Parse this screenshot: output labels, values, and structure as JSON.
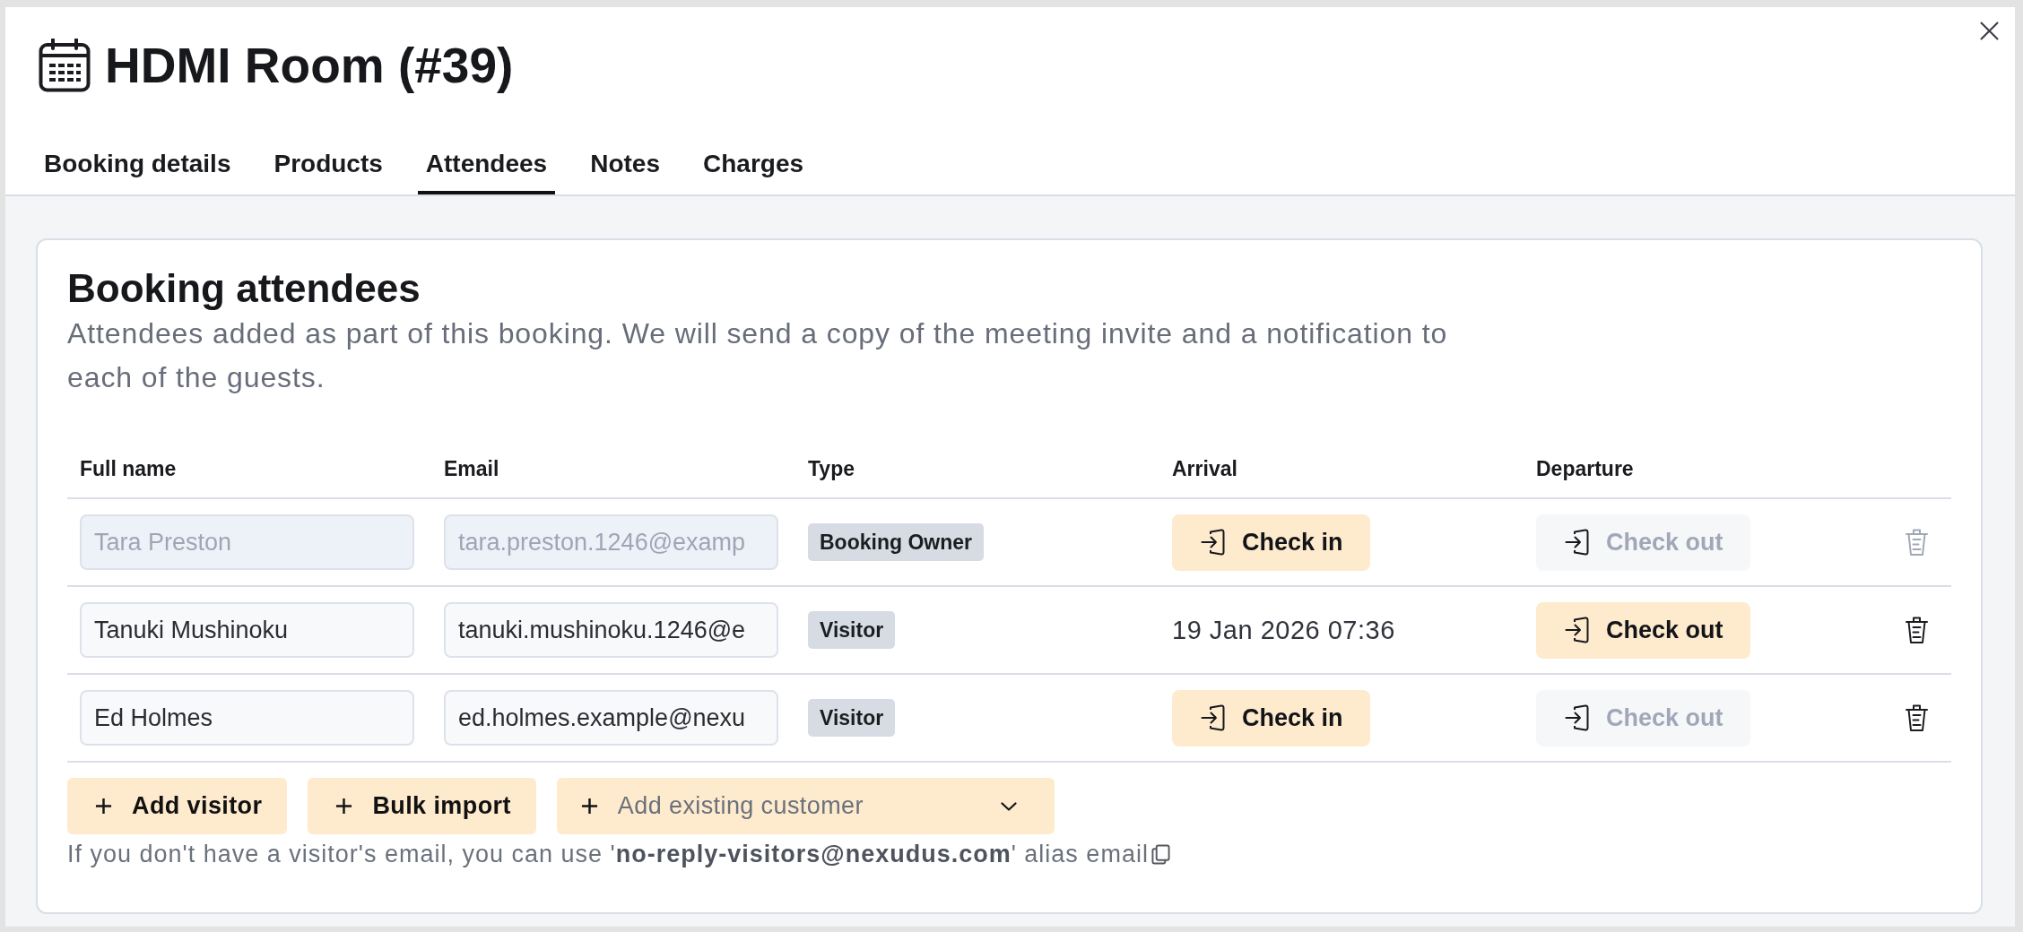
{
  "window": {
    "title": "HDMI Room (#39)"
  },
  "tabs": [
    {
      "label": "Booking details",
      "selected": false
    },
    {
      "label": "Products",
      "selected": false
    },
    {
      "label": "Attendees",
      "selected": true
    },
    {
      "label": "Notes",
      "selected": false
    },
    {
      "label": "Charges",
      "selected": false
    }
  ],
  "section": {
    "title": "Booking attendees",
    "description": "Attendees added as part of this booking. We will send a copy of the meeting invite and a notification to each of the guests."
  },
  "table": {
    "columns": [
      "Full name",
      "Email",
      "Type",
      "Arrival",
      "Departure"
    ],
    "rows": [
      {
        "full_name": "Tara Preston",
        "email": "tara.preston.1246@examp",
        "fields_disabled": true,
        "type": "Booking Owner",
        "arrival": {
          "kind": "button",
          "label": "Check in"
        },
        "departure": {
          "label": "Check out",
          "disabled": true
        },
        "delete_disabled": true
      },
      {
        "full_name": "Tanuki Mushinoku",
        "email": "tanuki.mushinoku.1246@e",
        "fields_disabled": false,
        "type": "Visitor",
        "arrival": {
          "kind": "time",
          "text": "19 Jan 2026 07:36"
        },
        "departure": {
          "label": "Check out",
          "disabled": false
        },
        "delete_disabled": false
      },
      {
        "full_name": "Ed Holmes",
        "email": "ed.holmes.example@nexu",
        "fields_disabled": false,
        "type": "Visitor",
        "arrival": {
          "kind": "button",
          "label": "Check in"
        },
        "departure": {
          "label": "Check out",
          "disabled": true
        },
        "delete_disabled": false
      }
    ]
  },
  "actions": [
    {
      "kind": "button",
      "label": "Add visitor"
    },
    {
      "kind": "button",
      "label": "Bulk import"
    },
    {
      "kind": "dropdown",
      "placeholder": "Add existing customer"
    }
  ],
  "note": "If you don't have a visitor's email, you can use '**no-reply-visitors@nexudus.com**' alias email"
}
